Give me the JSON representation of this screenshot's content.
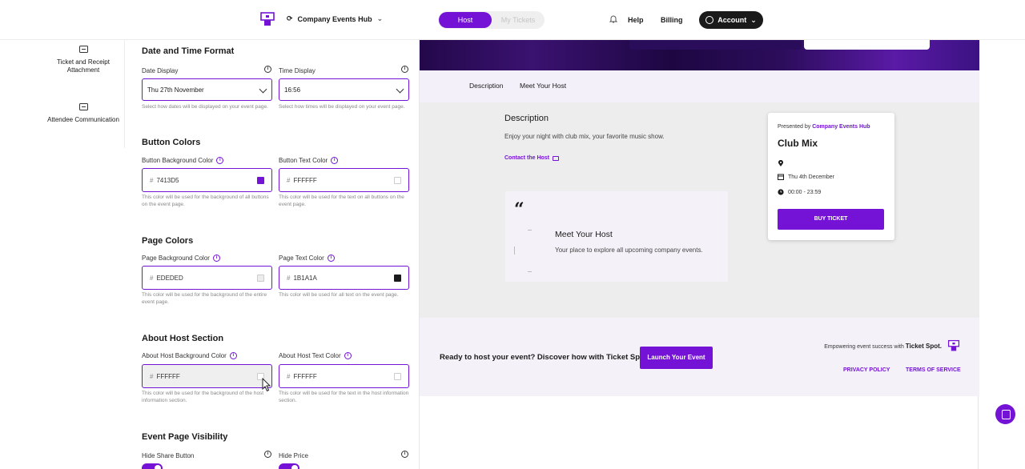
{
  "header": {
    "org_name": "Company Events Hub",
    "mode_switch": {
      "active": "Host",
      "inactive": "My Tickets"
    },
    "help": "Help",
    "billing": "Billing",
    "account": "Account"
  },
  "leftnav": {
    "items": [
      {
        "label": "Ticket and Receipt Attachment",
        "icon": "ticket-icon"
      },
      {
        "label": "Attendee Communication",
        "icon": "ticket-icon"
      }
    ]
  },
  "settings": {
    "datetime": {
      "title": "Date and Time Format",
      "date_label": "Date Display",
      "date_value": "Thu 27th November",
      "date_help": "Select how dates will be displayed on your event page.",
      "time_label": "Time Display",
      "time_value": "16:56",
      "time_help": "Select how times will be displayed on your event page."
    },
    "button_colors": {
      "title": "Button Colors",
      "bg_label": "Button Background Color",
      "bg_value": "7413D5",
      "bg_help": "This color will be used for the background of all buttons on the event page.",
      "text_label": "Button Text Color",
      "text_value": "FFFFFF",
      "text_help": "This color will be used for the text on all buttons on the event page."
    },
    "page_colors": {
      "title": "Page Colors",
      "bg_label": "Page Background Color",
      "bg_value": "EDEDED",
      "bg_help": "This color will be used for the background of the entire event page.",
      "text_label": "Page Text Color",
      "text_value": "1B1A1A",
      "text_help": "This color will be used for all text on the event page."
    },
    "host_section": {
      "title": "About Host Section",
      "bg_label": "About Host Background Color",
      "bg_value": "FFFFFF",
      "bg_help": "This color will be used for the background of the host information section.",
      "text_label": "About Host Text Color",
      "text_value": "FFFFFF",
      "text_help": "This color will be used for the text in the host information section."
    },
    "visibility": {
      "title": "Event Page Visibility",
      "share_label": "Hide Share Button",
      "share_on": true,
      "price_label": "Hide Price",
      "price_on": true
    }
  },
  "preview": {
    "tabs": [
      "Description",
      "Meet Your Host"
    ],
    "description_title": "Description",
    "description_text": "Enjoy your night with club mix, your favorite music show.",
    "contact": "Contact the Host",
    "quote_mark": "“",
    "host_title": "Meet Your Host",
    "host_text": "Your place to explore all upcoming company events.",
    "card": {
      "presented_by": "Presented by",
      "org": "Company Events Hub",
      "event_name": "Club Mix",
      "date": "Thu 4th December",
      "time": "00:00 - 23:59",
      "buy": "BUY TICKET"
    },
    "footer": {
      "cta_text": "Ready to host your event? Discover how with Ticket Spot.",
      "cta_button": "Launch Your Event",
      "empower": "Empowering event success with",
      "brand": "Ticket Spot.",
      "privacy": "PRIVACY POLICY",
      "terms": "TERMS OF SERVICE"
    }
  },
  "colors": {
    "accent": "#7413d5",
    "page_bg": "#ededed",
    "text": "#1b1a1a"
  }
}
